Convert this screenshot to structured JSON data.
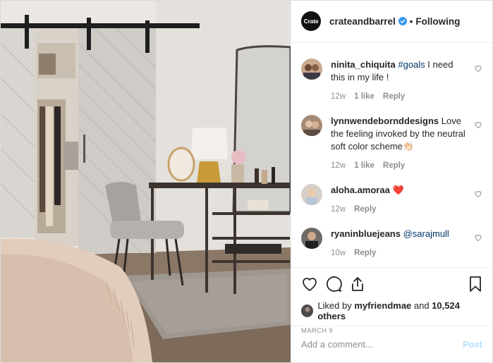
{
  "header": {
    "brand_avatar_text": "Crate",
    "username": "crateandbarrel",
    "separator": "•",
    "follow_label": "Following"
  },
  "comments": [
    {
      "user": "ninita_chiquita",
      "tag": "#goals",
      "text": " I need this in my life !",
      "age": "12w",
      "likes": "1 like",
      "reply": "Reply"
    },
    {
      "user": "lynnwendebornddesigns",
      "tag": "",
      "text": " Love the feeling invoked by the neutral soft color scheme👏🏻",
      "age": "12w",
      "likes": "1 like",
      "reply": "Reply"
    },
    {
      "user": "aloha.amoraa",
      "tag": "",
      "text": " ❤️",
      "age": "12w",
      "likes": "",
      "reply": "Reply"
    },
    {
      "user": "ryaninbluejeans",
      "tag": "@sarajmull",
      "text": "",
      "age": "10w",
      "likes": "",
      "reply": "Reply"
    }
  ],
  "actions": {
    "icons": [
      "heart-icon",
      "comment-icon",
      "share-icon",
      "bookmark-icon"
    ],
    "liked_prefix": "Liked by ",
    "liked_user": "myfriendmae",
    "liked_mid": " and ",
    "liked_count": "10,524 others",
    "date": "MARCH 9"
  },
  "add_comment": {
    "placeholder": "Add a comment...",
    "post_label": "Post"
  }
}
